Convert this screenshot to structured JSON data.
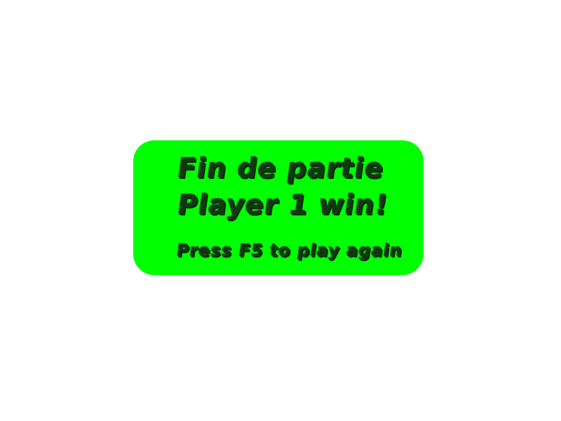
{
  "end_screen": {
    "title": "Fin de partie",
    "result": "Player 1 win!",
    "hint": "Press F5 to play again"
  },
  "colors": {
    "background": "#ffffff",
    "panel": "#00ff00",
    "text": "#0f3a0f"
  }
}
